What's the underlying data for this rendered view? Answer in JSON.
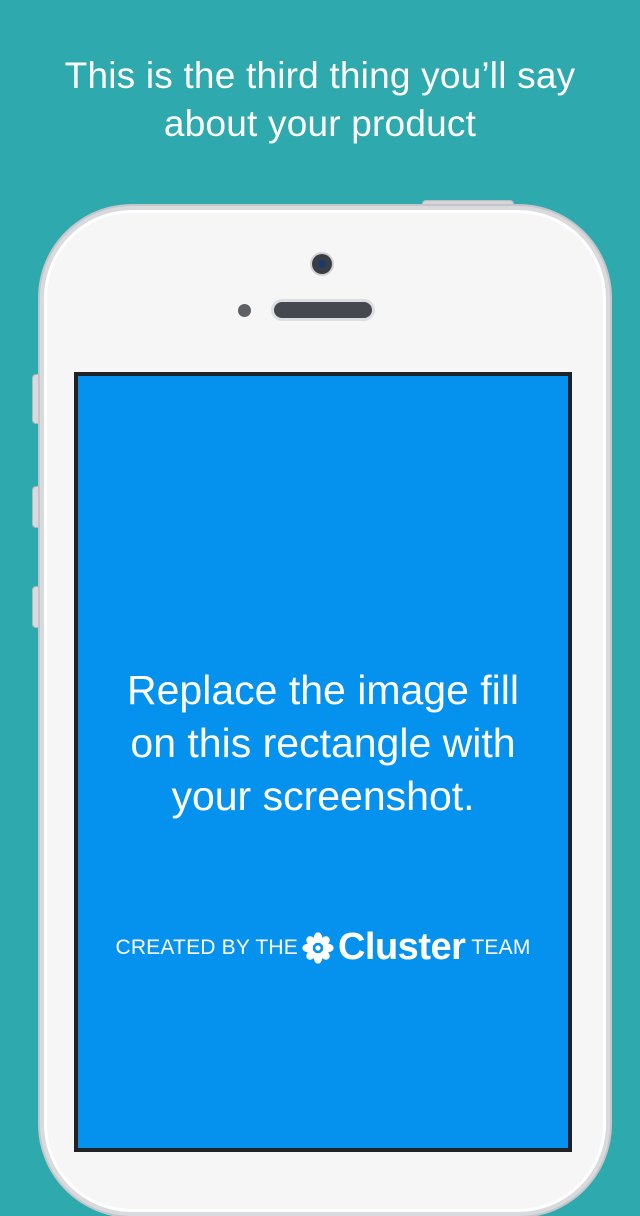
{
  "headline": {
    "line1": "This is the third thing you’ll say",
    "line2": "about your product"
  },
  "screen": {
    "message_line1": "Replace the image fill",
    "message_line2": "on this rectangle with",
    "message_line3": "your screenshot.",
    "credit_prefix": "CREATED BY THE",
    "credit_brand": "Cluster",
    "credit_suffix": "TEAM",
    "brand_icon": "flower-icon"
  },
  "colors": {
    "background": "#2eaaae",
    "screen": "#0592ee",
    "text": "#ffffff"
  }
}
